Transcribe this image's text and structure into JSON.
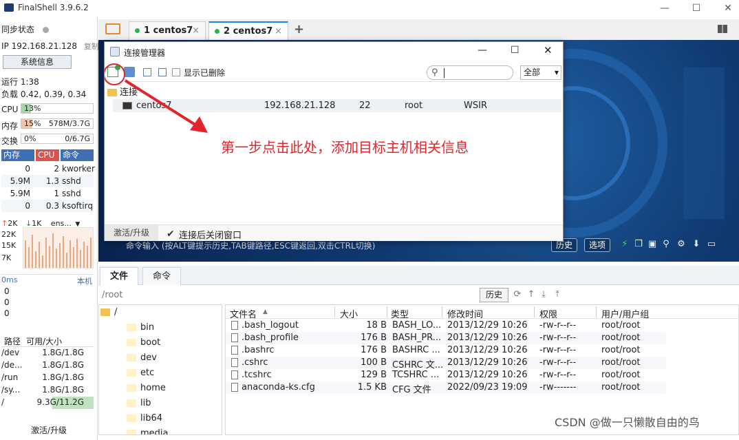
{
  "window": {
    "title": "FinalShell 3.9.6.2"
  },
  "left": {
    "sync_label": "同步状态",
    "ip_label": "IP 192.168.21.128",
    "copy_label": "复制",
    "sysinfo_button": "系统信息",
    "uptime": "运行 1:38",
    "load": "负载 0.42, 0.39, 0.34",
    "cpu": {
      "label": "CPU",
      "value": "13%",
      "pct": 13
    },
    "mem": {
      "label": "内存",
      "value": "15%",
      "detail": "578M/3.7G",
      "pct": 15
    },
    "swap": {
      "label": "交换",
      "value": "0%",
      "detail": "0/6.7G",
      "pct": 0
    },
    "proc_headers": [
      "内存",
      "CPU",
      "命令"
    ],
    "processes": [
      {
        "mem": "0",
        "cpu": "2",
        "cmd": "kworker"
      },
      {
        "mem": "5.9M",
        "cpu": "1.3",
        "cmd": "sshd"
      },
      {
        "mem": "5.9M",
        "cpu": "1",
        "cmd": "sshd"
      },
      {
        "mem": "0",
        "cpu": "0.3",
        "cmd": "ksoftirq"
      }
    ],
    "net": {
      "up": "2K",
      "down": "1K",
      "iface": "ens...",
      "ticks": [
        "22K",
        "15K",
        "7K"
      ]
    },
    "latency": {
      "label": "0ms",
      "host": "本机",
      "values": [
        "0",
        "0",
        "0"
      ]
    },
    "disk_headers": [
      "路径",
      "可用/大小"
    ],
    "disks": [
      {
        "path": "/dev",
        "size": "1.8G/1.8G"
      },
      {
        "path": "/de...",
        "size": "1.8G/1.8G"
      },
      {
        "path": "/run",
        "size": "1.8G/1.8G"
      },
      {
        "path": "/sy...",
        "size": "1.8G/1.8G"
      },
      {
        "path": "/",
        "size": "9.3G/11.2G"
      }
    ],
    "upgrade": "激活/升级"
  },
  "tabs": [
    {
      "label": "1 centos7"
    },
    {
      "label": "2 centos7"
    }
  ],
  "terminal": {
    "hint": "命令输入 (按ALT键提示历史,TAB键路径,ESC键返回,双击CTRL切换)",
    "history_btn": "历史",
    "options_btn": "选项"
  },
  "dialog": {
    "title": "连接管理器",
    "show_deleted": "显示已删除",
    "filter": "全部",
    "folder": "连接",
    "connection": {
      "name": "centos7",
      "host": "192.168.21.128",
      "port": "22",
      "user": "root",
      "desc": "WSIR"
    },
    "upgrade": "激活/升级",
    "close_after": "连接后关闭窗口",
    "annotation": "第一步点击此处，添加目标主机相关信息"
  },
  "bottom": {
    "tabs": [
      "文件",
      "命令"
    ],
    "path": "/root",
    "history_btn": "历史",
    "tree": [
      "/",
      "bin",
      "boot",
      "dev",
      "etc",
      "home",
      "lib",
      "lib64",
      "media"
    ],
    "columns": [
      "文件名",
      "大小",
      "类型",
      "修改时间",
      "权限",
      "用户/用户组"
    ],
    "files": [
      {
        "name": ".bash_logout",
        "size": "18 B",
        "type": "BASH_LO...",
        "mtime": "2013/12/29 10:26",
        "perm": "-rw-r--r--",
        "owner": "root/root"
      },
      {
        "name": ".bash_profile",
        "size": "176 B",
        "type": "BASH_PR...",
        "mtime": "2013/12/29 10:26",
        "perm": "-rw-r--r--",
        "owner": "root/root"
      },
      {
        "name": ".bashrc",
        "size": "176 B",
        "type": "BASHRC ...",
        "mtime": "2013/12/29 10:26",
        "perm": "-rw-r--r--",
        "owner": "root/root"
      },
      {
        "name": ".cshrc",
        "size": "100 B",
        "type": "CSHRC 文...",
        "mtime": "2013/12/29 10:26",
        "perm": "-rw-r--r--",
        "owner": "root/root"
      },
      {
        "name": ".tcshrc",
        "size": "129 B",
        "type": "TCSHRC ...",
        "mtime": "2013/12/29 10:26",
        "perm": "-rw-r--r--",
        "owner": "root/root"
      },
      {
        "name": "anaconda-ks.cfg",
        "size": "1.5 KB",
        "type": "CFG 文件",
        "mtime": "2022/09/23 19:09",
        "perm": "-rw-------",
        "owner": "root/root"
      }
    ]
  },
  "watermark": "CSDN @做一只懒散自由的鸟",
  "colors": {
    "accent": "#1e88e5",
    "proc_head": "#3f6fb5",
    "cpu_head": "#d9534f",
    "annotation": "#e3242b",
    "online": "#2cb34a"
  }
}
